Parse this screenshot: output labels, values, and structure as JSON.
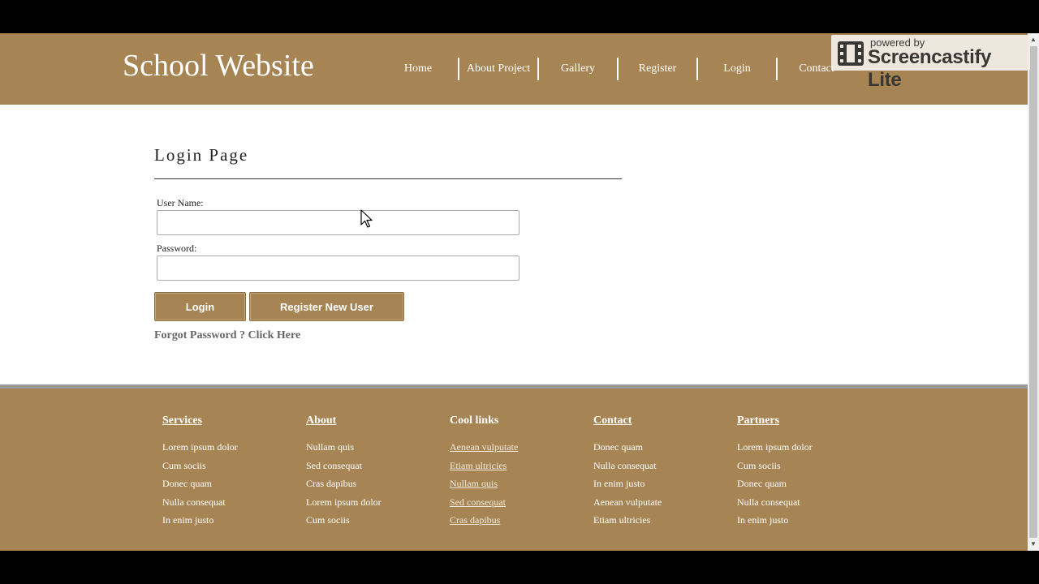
{
  "site": {
    "title": "School Website"
  },
  "nav": {
    "items": [
      "Home",
      "About Project",
      "Gallery",
      "Register",
      "Login",
      "Contact"
    ]
  },
  "watermark": {
    "small": "powered by",
    "big": "Screencastify Lite"
  },
  "login": {
    "heading": "Login Page",
    "username_label": "User Name:",
    "username_value": "",
    "password_label": "Password:",
    "password_value": "",
    "login_button": "Login",
    "register_button": "Register New User",
    "forgot_text": "Forgot Password ? Click Here"
  },
  "footer": {
    "columns": [
      {
        "heading": "Services",
        "links": false,
        "items": [
          "Lorem ipsum dolor",
          "Cum sociis",
          "Donec quam",
          "Nulla consequat",
          "In enim justo"
        ]
      },
      {
        "heading": "About",
        "links": false,
        "items": [
          "Nullam quis",
          "Sed consequat",
          "Cras dapibus",
          "Lorem ipsum dolor",
          "Cum sociis"
        ]
      },
      {
        "heading": "Cool links",
        "links": true,
        "items": [
          "Aenean vulputate",
          "Etiam ultricies",
          "Nullam quis",
          "Sed consequat",
          "Cras dapibus"
        ]
      },
      {
        "heading": "Contact",
        "links": false,
        "items": [
          "Donec quam",
          "Nulla consequat",
          "In enim justo",
          "Aenean vulputate",
          "Etiam ultricies"
        ]
      },
      {
        "heading": "Partners",
        "links": false,
        "items": [
          "Lorem ipsum dolor",
          "Cum sociis",
          "Donec quam",
          "Nulla consequat",
          "In enim justo"
        ]
      }
    ]
  },
  "colors": {
    "brand": "#a68453",
    "footer_border": "#9a9a9a",
    "background": "#ffffff"
  },
  "icons": {
    "watermark": "film-icon",
    "cursor": "mouse-pointer-icon"
  }
}
